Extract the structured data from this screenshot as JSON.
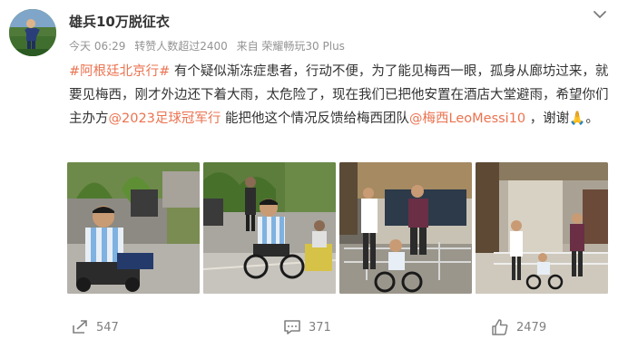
{
  "post": {
    "author": "雄兵10万脱征衣",
    "time": "今天 06:29",
    "reposts_note": "转赞人数超过2400",
    "source": "来自 荣耀畅玩30 Plus",
    "hashtag": "#阿根廷北京行#",
    "text_1": " 有个疑似渐冻症患者，行动不便，为了能见梅西一眼，孤身从廊坊过来，就要见梅西，刚才外边还下着大雨，太危险了，现在我们已把他安置在酒店大堂避雨，希望你们主办方",
    "mention_1": "@2023足球冠军行",
    "text_2": " 能把他这个情况反馈给梅西团队",
    "mention_2": "@梅西LeoMessi10",
    "text_3": " ，谢谢",
    "emoji": "🙏",
    "text_end": "。"
  },
  "actions": {
    "repost_count": "547",
    "comment_count": "371",
    "like_count": "2479"
  },
  "icons": {
    "avatar": "avatar-image",
    "menu": "chevron-down-icon",
    "repost": "repost-icon",
    "comment": "comment-icon",
    "like": "thumbs-up-icon"
  },
  "colors": {
    "link": "#eb7350",
    "meta": "#939393",
    "text": "#333333"
  }
}
